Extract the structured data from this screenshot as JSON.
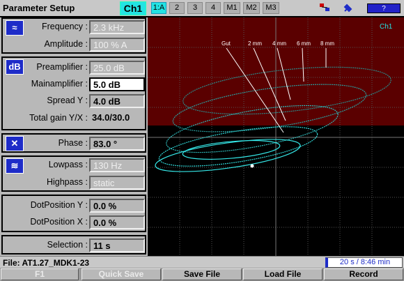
{
  "header": {
    "title": "Parameter Setup",
    "channel": "Ch1",
    "tabs": [
      "1:A",
      "2",
      "3",
      "4",
      "M1",
      "M2",
      "M3"
    ],
    "active_tab": "1:A",
    "icons": [
      "network-icon",
      "usb-icon",
      "power-plug-icon"
    ],
    "help_label": "?"
  },
  "params": {
    "frequency": {
      "label": "Frequency :",
      "value": "2.3 kHz"
    },
    "amplitude": {
      "label": "Amplitude :",
      "value": "100 % A"
    },
    "preamplifier": {
      "label": "Preamplifier :",
      "value": "25.0 dB"
    },
    "mainamplifier": {
      "label": "Mainamplifier :",
      "value": "5.0 dB"
    },
    "spread_y": {
      "label": "Spread Y :",
      "value": "4.0 dB"
    },
    "total_gain": {
      "label": "Total gain Y/X :",
      "value": "34.0/30.0"
    },
    "phase": {
      "label": "Phase :",
      "value": "83.0 °"
    },
    "lowpass": {
      "label": "Lowpass :",
      "value": "130 Hz"
    },
    "highpass": {
      "label": "Highpass :",
      "value": "static"
    },
    "dot_y": {
      "label": "DotPosition Y :",
      "value": "0.0 %"
    },
    "dot_x": {
      "label": "DotPosition X :",
      "value": "0.0 %"
    },
    "selection": {
      "label": "Selection :",
      "value": "11 s"
    }
  },
  "section_icons": {
    "frequency": "sine-wave-icon",
    "gain": "dB",
    "phase": "phase-icon",
    "filter": "filter-icon"
  },
  "plot": {
    "channel_label": "Ch1",
    "annotations": [
      "Gut",
      "2 mm",
      "4 mm",
      "6 mm",
      "8 mm"
    ],
    "colors": {
      "alarm_zone": "#5a0000",
      "background": "#000000",
      "trace": "#2fd6d6",
      "grid": "#555555"
    }
  },
  "status": {
    "file": "File: AT1.27_MDK1-23",
    "time": "20 s / 8:46 min"
  },
  "softkeys": [
    "F1",
    "Quick Save",
    "Save File",
    "Load File",
    "Record"
  ]
}
